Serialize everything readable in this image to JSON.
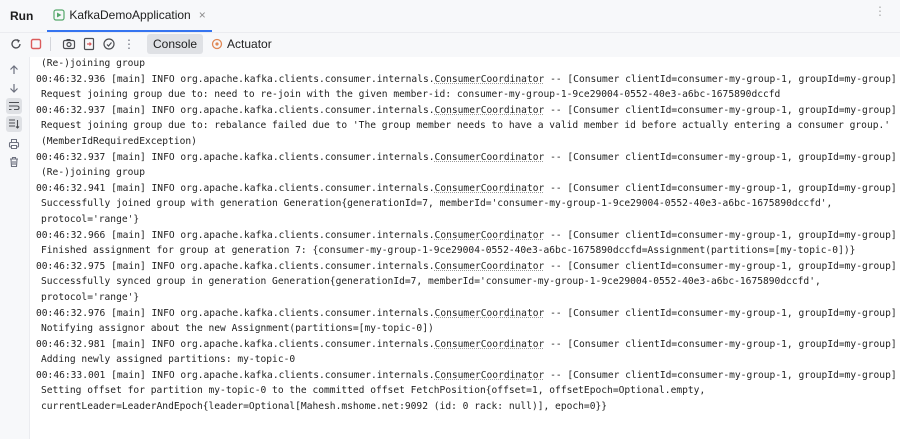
{
  "header": {
    "run_label": "Run",
    "tab_title": "KafkaDemoApplication",
    "tab_close": "×",
    "more": "⋮"
  },
  "toolbar": {
    "console_tab": "Console",
    "actuator_tab": "Actuator",
    "more": "⋮"
  },
  "console": {
    "lines": [
      {
        "kind": "cont",
        "text": "(Re-)joining group"
      },
      {
        "kind": "log",
        "prefix": "00:46:32.936 [main] INFO org.apache.kafka.clients.consumer.internals.",
        "cls": "ConsumerCoordinator",
        "suffix": " -- [Consumer clientId=consumer-my-group-1, groupId=my-group]"
      },
      {
        "kind": "cont",
        "text": "Request joining group due to: need to re-join with the given member-id: consumer-my-group-1-9ce29004-0552-40e3-a6bc-1675890dccfd"
      },
      {
        "kind": "log",
        "prefix": "00:46:32.937 [main] INFO org.apache.kafka.clients.consumer.internals.",
        "cls": "ConsumerCoordinator",
        "suffix": " -- [Consumer clientId=consumer-my-group-1, groupId=my-group]"
      },
      {
        "kind": "cont",
        "text": "Request joining group due to: rebalance failed due to 'The group member needs to have a valid member id before actually entering a consumer group.'"
      },
      {
        "kind": "cont",
        "text": "(MemberIdRequiredException)"
      },
      {
        "kind": "log",
        "prefix": "00:46:32.937 [main] INFO org.apache.kafka.clients.consumer.internals.",
        "cls": "ConsumerCoordinator",
        "suffix": " -- [Consumer clientId=consumer-my-group-1, groupId=my-group]"
      },
      {
        "kind": "cont",
        "text": "(Re-)joining group"
      },
      {
        "kind": "log",
        "prefix": "00:46:32.941 [main] INFO org.apache.kafka.clients.consumer.internals.",
        "cls": "ConsumerCoordinator",
        "suffix": " -- [Consumer clientId=consumer-my-group-1, groupId=my-group]"
      },
      {
        "kind": "cont",
        "text": "Successfully joined group with generation Generation{generationId=7, memberId='consumer-my-group-1-9ce29004-0552-40e3-a6bc-1675890dccfd',"
      },
      {
        "kind": "cont",
        "text": "protocol='range'}"
      },
      {
        "kind": "log",
        "prefix": "00:46:32.966 [main] INFO org.apache.kafka.clients.consumer.internals.",
        "cls": "ConsumerCoordinator",
        "suffix": " -- [Consumer clientId=consumer-my-group-1, groupId=my-group]"
      },
      {
        "kind": "cont",
        "text": "Finished assignment for group at generation 7: {consumer-my-group-1-9ce29004-0552-40e3-a6bc-1675890dccfd=Assignment(partitions=[my-topic-0])}"
      },
      {
        "kind": "log",
        "prefix": "00:46:32.975 [main] INFO org.apache.kafka.clients.consumer.internals.",
        "cls": "ConsumerCoordinator",
        "suffix": " -- [Consumer clientId=consumer-my-group-1, groupId=my-group]"
      },
      {
        "kind": "cont",
        "text": "Successfully synced group in generation Generation{generationId=7, memberId='consumer-my-group-1-9ce29004-0552-40e3-a6bc-1675890dccfd',"
      },
      {
        "kind": "cont",
        "text": "protocol='range'}"
      },
      {
        "kind": "log",
        "prefix": "00:46:32.976 [main] INFO org.apache.kafka.clients.consumer.internals.",
        "cls": "ConsumerCoordinator",
        "suffix": " -- [Consumer clientId=consumer-my-group-1, groupId=my-group]"
      },
      {
        "kind": "cont",
        "text": "Notifying assignor about the new Assignment(partitions=[my-topic-0])"
      },
      {
        "kind": "log",
        "prefix": "00:46:32.981 [main] INFO org.apache.kafka.clients.consumer.internals.",
        "cls": "ConsumerCoordinator",
        "suffix": " -- [Consumer clientId=consumer-my-group-1, groupId=my-group]"
      },
      {
        "kind": "cont",
        "text": "Adding newly assigned partitions: my-topic-0"
      },
      {
        "kind": "log",
        "prefix": "00:46:33.001 [main] INFO org.apache.kafka.clients.consumer.internals.",
        "cls": "ConsumerCoordinator",
        "suffix": " -- [Consumer clientId=consumer-my-group-1, groupId=my-group]"
      },
      {
        "kind": "cont",
        "text": "Setting offset for partition my-topic-0 to the committed offset FetchPosition{offset=1, offsetEpoch=Optional.empty,"
      },
      {
        "kind": "cont",
        "text": "currentLeader=LeaderAndEpoch{leader=Optional[Mahesh.mshome.net:9092 (id: 0 rack: null)], epoch=0}}"
      }
    ]
  },
  "colors": {
    "accent": "#3574f0",
    "stop_red": "#db5c5c",
    "actuator_orange": "#e08855"
  },
  "icons": {
    "tab": "spring-boot-run-icon",
    "rerun": "rerun-icon",
    "stop": "stop-icon",
    "camera": "screenshot-icon",
    "export": "export-icon",
    "debug": "attach-debugger-icon",
    "actuator": "actuator-icon",
    "up": "arrow-up-icon",
    "down": "arrow-down-icon",
    "wrap": "soft-wrap-icon",
    "scroll": "scroll-to-end-icon",
    "print": "print-icon",
    "trash": "trash-icon"
  }
}
